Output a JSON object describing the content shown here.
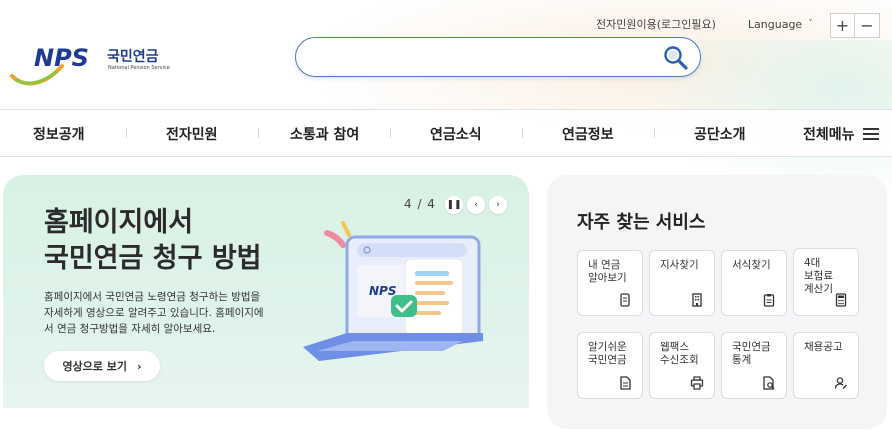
{
  "header": {
    "civil_link": "전자민원이용(로그인필요)",
    "language_label": "Language",
    "zoom_in": "+",
    "zoom_out": "−",
    "logo_text": "NPS",
    "logo_korean": "국민연금",
    "logo_english": "National Pension Service",
    "search_placeholder": ""
  },
  "nav": {
    "items": [
      {
        "label": "정보공개"
      },
      {
        "label": "전자민원"
      },
      {
        "label": "소통과 참여"
      },
      {
        "label": "연금소식"
      },
      {
        "label": "연금정보"
      },
      {
        "label": "공단소개"
      }
    ],
    "all_menu": "전체메뉴"
  },
  "banner": {
    "title_line1": "홈페이지에서",
    "title_line2": "국민연금 청구 방법",
    "desc_line1": "홈페이지에서 국민연금 노령연금 청구하는 방법을",
    "desc_line2": "자세하게 영상으로 알려주고 있습니다. 홈페이지에",
    "desc_line3": "서 연금 청구방법을 자세히 알아보세요.",
    "cta_label": "영상으로 보기",
    "pager": "4 / 4",
    "illus_logo": "NPS"
  },
  "services": {
    "title": "자주 찾는 서비스",
    "cards": [
      {
        "label": "내 연금\n알아보기",
        "icon": "phone-doc-icon"
      },
      {
        "label": "지사찾기",
        "icon": "building-icon"
      },
      {
        "label": "서식찾기",
        "icon": "clipboard-icon"
      },
      {
        "label": "4대\n보험료\n계산기",
        "icon": "calculator-icon"
      },
      {
        "label": "알기쉬운\n국민연금",
        "icon": "document-icon"
      },
      {
        "label": "웹팩스\n수신조회",
        "icon": "printer-icon"
      },
      {
        "label": "국민연금\n통계",
        "icon": "search-doc-icon"
      },
      {
        "label": "채용공고",
        "icon": "person-edit-icon"
      }
    ]
  },
  "colors": {
    "brand_blue": "#1f3a93",
    "search_border": "#4b7cc9",
    "banner_bg": "#d9f1e4"
  }
}
